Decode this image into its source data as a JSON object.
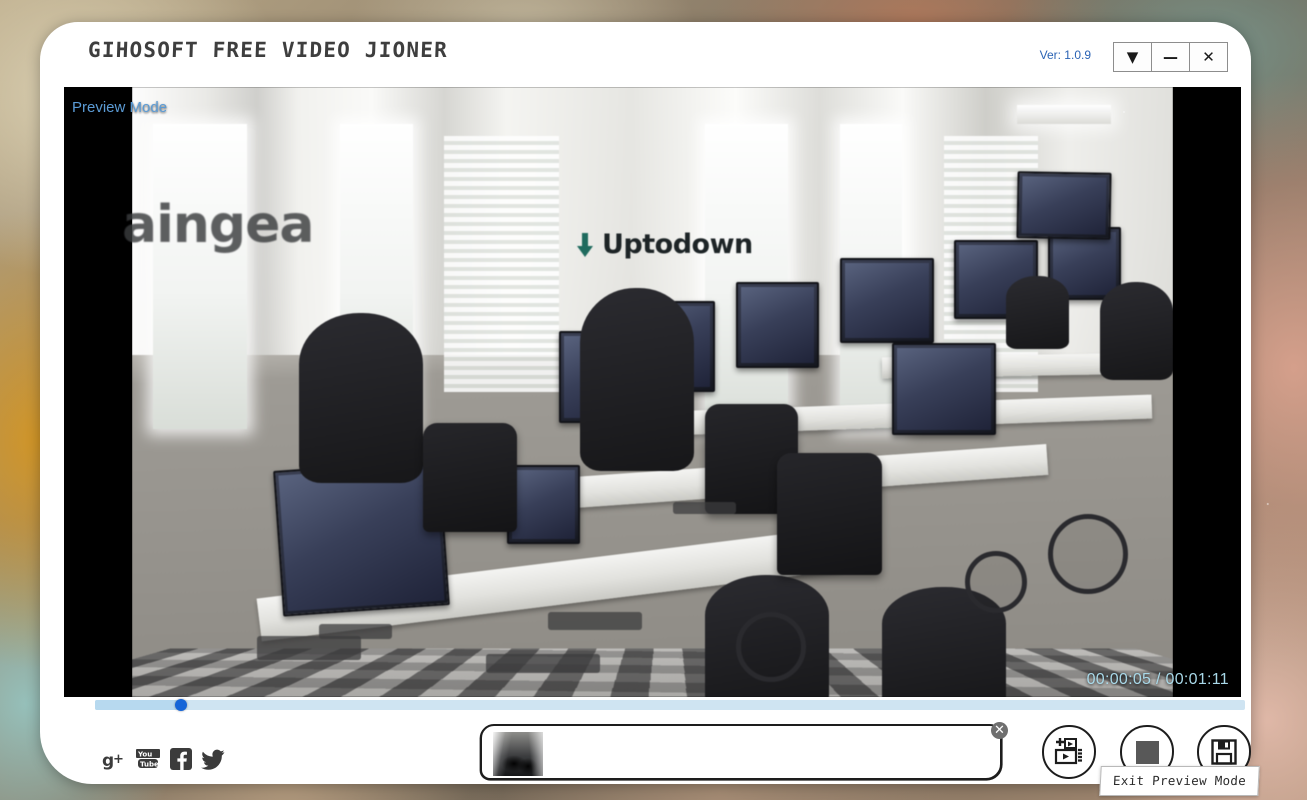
{
  "window": {
    "title": "GIHOSOFT FREE VIDEO JIONER",
    "version_label": "Ver: 1.0.9",
    "controls": {
      "dropdown": "▼",
      "minimize": "—",
      "close": "✕"
    }
  },
  "video": {
    "preview_badge": "Preview Mode",
    "time_display": "00:00:05 / 00:01:11",
    "current_time": "00:00:05",
    "total_time": "00:01:11",
    "progress_percent": 7.5,
    "wall_text": "aingea",
    "watermark_text": "Uptodown"
  },
  "social": {
    "items": [
      {
        "name": "googleplus-icon",
        "label": "g+"
      },
      {
        "name": "youtube-icon",
        "label": "YouTube"
      },
      {
        "name": "facebook-icon",
        "label": "f"
      },
      {
        "name": "twitter-icon",
        "label": "Twitter"
      }
    ]
  },
  "playlist": {
    "items": [
      {
        "name": "video-thumbnail",
        "close_label": "✕"
      }
    ]
  },
  "actions": {
    "add_video": {
      "name": "add-video-icon",
      "label": "Add Video"
    },
    "stop": {
      "name": "stop-icon",
      "label": "Stop"
    },
    "save": {
      "name": "save-icon",
      "label": "Save"
    }
  },
  "tooltip": {
    "text": "Exit Preview Mode"
  },
  "colors": {
    "accent_blue": "#1565d8",
    "version_blue": "#2a63b4",
    "preview_blue": "#5b9bd5",
    "time_cyan": "#a8d8e8",
    "seek_track": "#cfe4f2",
    "ink": "#1d1d1d"
  }
}
